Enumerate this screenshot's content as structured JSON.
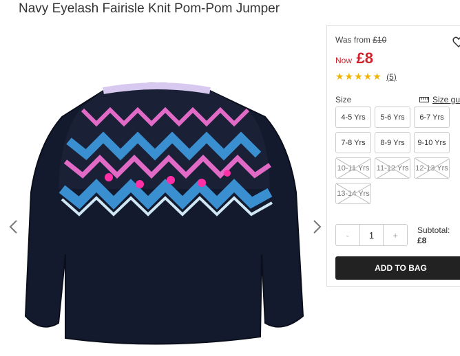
{
  "product": {
    "title": "Navy Eyelash Fairisle Knit Pom-Pom Jumper"
  },
  "price": {
    "was_label": "Was from",
    "was_value": "£10",
    "now_label": "Now",
    "now_value": "£8"
  },
  "rating": {
    "stars": "★★★★★",
    "count": "(5)",
    "value": 5,
    "max": 5
  },
  "sizes": {
    "label": "Size",
    "guide_label": "Size gui",
    "options": [
      {
        "label": "4-5 Yrs",
        "available": true
      },
      {
        "label": "5-6 Yrs",
        "available": true
      },
      {
        "label": "6-7 Yrs",
        "available": true
      },
      {
        "label": "7-8 Yrs",
        "available": true
      },
      {
        "label": "8-9 Yrs",
        "available": true
      },
      {
        "label": "9-10 Yrs",
        "available": true
      },
      {
        "label": "10-11 Yrs",
        "available": false
      },
      {
        "label": "11-12 Yrs",
        "available": false
      },
      {
        "label": "12-13 Yrs",
        "available": false
      },
      {
        "label": "13-14 Yrs",
        "available": false
      }
    ]
  },
  "quantity": {
    "decrement": "-",
    "value": "1",
    "increment": "+"
  },
  "subtotal": {
    "label": "Subtotal:",
    "value": "£8"
  },
  "cart": {
    "add_label": "ADD TO BAG"
  },
  "gallery": {
    "prev_icon": "chevron-left-icon",
    "next_icon": "chevron-right-icon"
  },
  "colors": {
    "price_red": "#d0202a",
    "star": "#f0b400",
    "button": "#222222",
    "jumper_navy": "#131a2e"
  }
}
